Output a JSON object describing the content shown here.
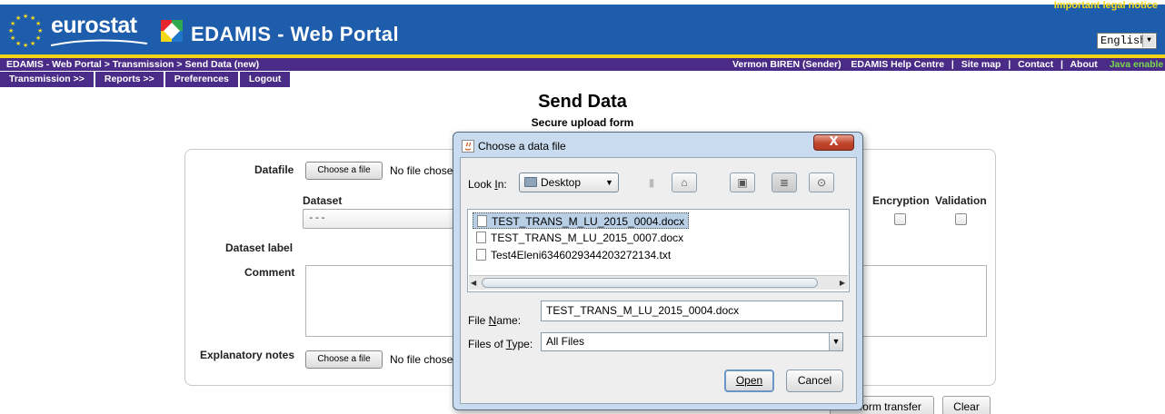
{
  "header": {
    "brand": "eurostat",
    "portal_title": "EDAMIS - Web Portal",
    "legal_notice": "Important legal notice",
    "language": "English",
    "colors": {
      "header_bg": "#1e5dab",
      "nav_bg": "#4a2c88",
      "accent_yellow": "#f3d515",
      "java_green": "#7ad84a"
    }
  },
  "breadcrumb": "EDAMIS - Web Portal > Transmission > Send Data (new)",
  "user_links": {
    "user": "Vermon BIREN (Sender)",
    "help": "EDAMIS Help Centre",
    "sep1": "|",
    "sitemap": "Site map",
    "sep2": "|",
    "contact": "Contact",
    "sep3": "|",
    "about": "About",
    "java_status": "Java enable"
  },
  "menu": [
    "Transmission >>",
    "Reports >>",
    "Preferences",
    "Logout"
  ],
  "page": {
    "title": "Send Data",
    "subtitle": "Secure upload form"
  },
  "form": {
    "datafile_label": "Datafile",
    "choose_file_label": "Choose a file",
    "no_file_text": "No file chose",
    "dataset_label": "Dataset",
    "dataset_value": "---",
    "dataset_label_label": "Dataset label",
    "comment_label": "Comment",
    "explanatory_notes_label": "Explanatory notes",
    "encryption_label": "Encryption",
    "validation_label": "Validation",
    "perform_transfer_label": "Perform transfer",
    "clear_label": "Clear"
  },
  "dialog": {
    "title": "Choose a data file",
    "close_label": "X",
    "look_in_label": "Look In:",
    "look_in_value": "Desktop",
    "files": [
      {
        "name": "TEST_TRANS_M_LU_2015_0004.docx",
        "selected": true
      },
      {
        "name": "TEST_TRANS_M_LU_2015_0007.docx",
        "selected": false
      },
      {
        "name": "Test4Eleni6346029344203272134.txt",
        "selected": false
      }
    ],
    "file_name_label": "File Name:",
    "file_name_value": "TEST_TRANS_M_LU_2015_0004.docx",
    "files_of_type_label": "Files of Type:",
    "files_of_type_value": "All Files",
    "open_label": "Open",
    "cancel_label": "Cancel",
    "toolbar_icons": [
      "up-folder-icon",
      "home-icon",
      "new-folder-icon",
      "list-view-icon",
      "details-view-icon"
    ]
  }
}
